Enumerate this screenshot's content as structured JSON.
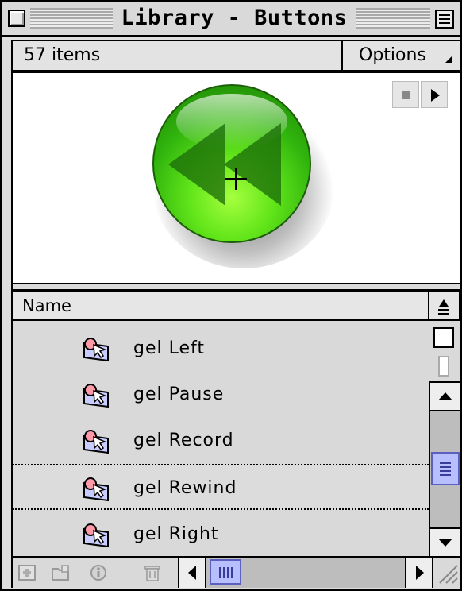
{
  "window": {
    "title": "Library - Buttons"
  },
  "info": {
    "item_count": "57 items",
    "options_label": "Options"
  },
  "preview": {
    "symbol_shown": "gel Rewind",
    "button_color": "#3cc414"
  },
  "list": {
    "column_name": "Name",
    "items": [
      {
        "label": "gel Left",
        "selected": false
      },
      {
        "label": "gel Pause",
        "selected": false
      },
      {
        "label": "gel Record",
        "selected": false
      },
      {
        "label": "gel Rewind",
        "selected": true
      },
      {
        "label": "gel Right",
        "selected": false
      }
    ]
  },
  "toolbar": {
    "icons": [
      "new-symbol-icon",
      "new-folder-icon",
      "properties-icon",
      "delete-icon"
    ]
  },
  "colors": {
    "scroll_thumb": "#b8bfff",
    "window_bg": "#dedede"
  }
}
